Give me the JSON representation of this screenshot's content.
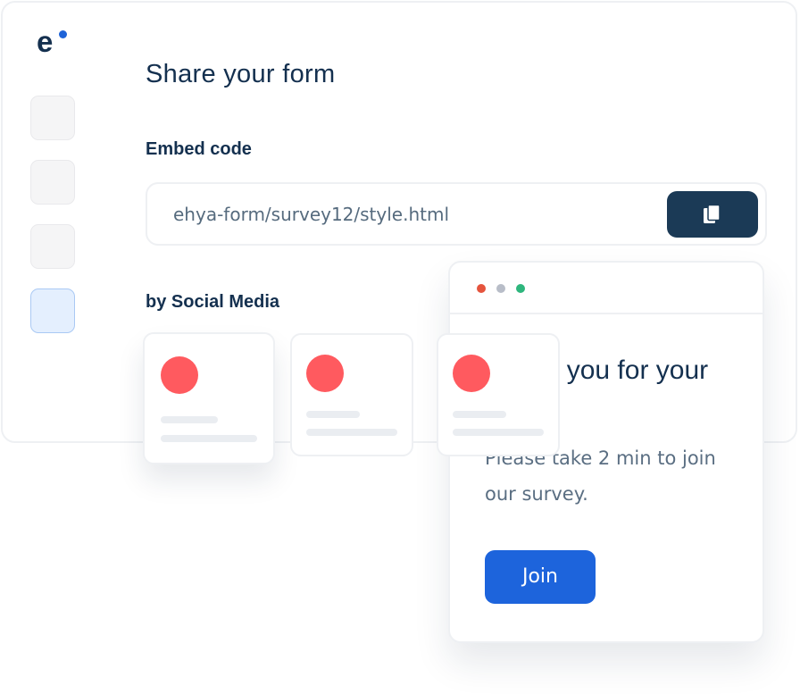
{
  "app": {
    "logo_text": "e",
    "accent_color": "#1e63d8"
  },
  "sidebar": {
    "items": [
      {
        "state": "default"
      },
      {
        "state": "default"
      },
      {
        "state": "default"
      },
      {
        "state": "active"
      }
    ]
  },
  "main": {
    "title": "Share your form",
    "embed": {
      "label": "Embed code",
      "value": "ehya-form/survey12/style.html",
      "copy_icon": "copy-icon"
    },
    "social": {
      "label": "by Social Media",
      "cards": [
        {
          "icon_color": "#ff5a5f"
        },
        {
          "icon_color": "#ff5a5f"
        },
        {
          "icon_color": "#ff5a5f"
        }
      ]
    }
  },
  "popup": {
    "window_dots": [
      "#e5543d",
      "#b8bdc8",
      "#2eb67d"
    ],
    "heading": "Thank you for your visit!",
    "body": "Please take 2 min to join our survey.",
    "join_label": "Join",
    "join_color": "#1d64dc"
  }
}
